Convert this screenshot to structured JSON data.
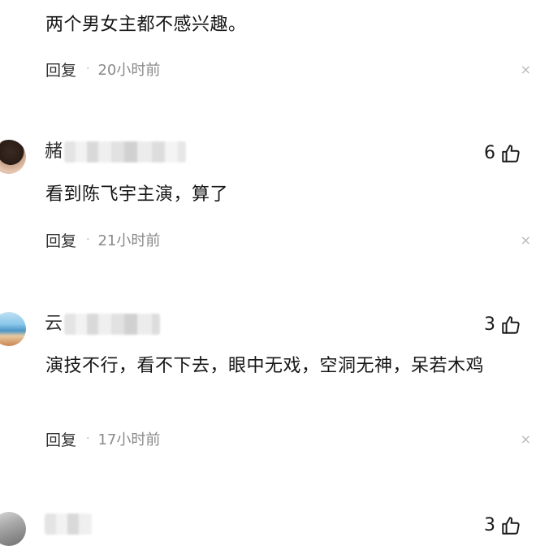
{
  "comments": [
    {
      "text": "两个男女主都不感兴趣。",
      "reply_label": "回复",
      "time": "20小时前",
      "close_glyph": "×"
    },
    {
      "username_initial": "赭",
      "likes": "6",
      "text": "看到陈飞宇主演，算了",
      "reply_label": "回复",
      "time": "21小时前",
      "close_glyph": "×"
    },
    {
      "username_initial": "云",
      "likes": "3",
      "text": "演技不行，看不下去，眼中无戏，空洞无神，呆若木鸡",
      "reply_label": "回复",
      "time": "17小时前",
      "close_glyph": "×"
    },
    {
      "likes": "3"
    }
  ],
  "icons": {
    "like": "thumbs-up-icon",
    "close": "close-icon"
  },
  "colors": {
    "text": "#151515",
    "meta": "#8a8a8a",
    "close": "#b8b8b8"
  }
}
